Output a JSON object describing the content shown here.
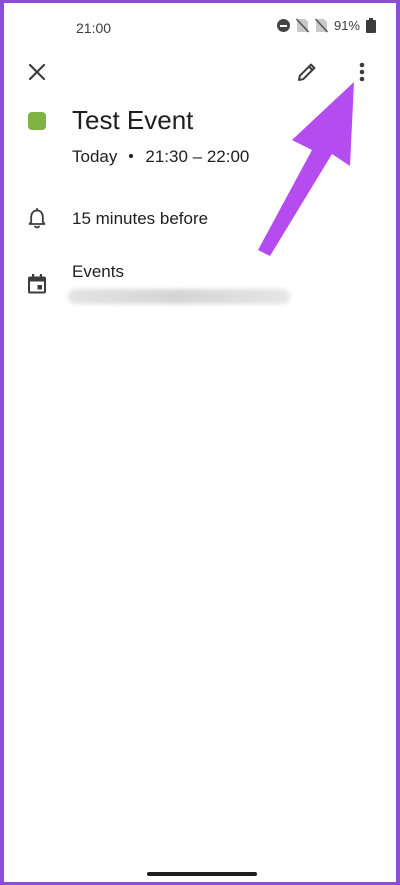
{
  "status_bar": {
    "time": "21:00",
    "battery": "91%",
    "icons": [
      "do-not-disturb-icon",
      "no-sim-icon",
      "no-sim-icon",
      "battery-icon"
    ]
  },
  "toolbar": {
    "icons": [
      "close-icon",
      "edit-pencil-icon",
      "more-vertical-icon"
    ]
  },
  "event": {
    "color": "#7cb342",
    "title": "Test Event",
    "day": "Today",
    "time_range": "21:30 – 22:00"
  },
  "reminder": {
    "icon": "bell-icon",
    "text": "15 minutes before"
  },
  "calendar": {
    "icon": "calendar-icon",
    "name": "Events"
  },
  "annotation": {
    "arrow_color": "#b44cf0"
  }
}
